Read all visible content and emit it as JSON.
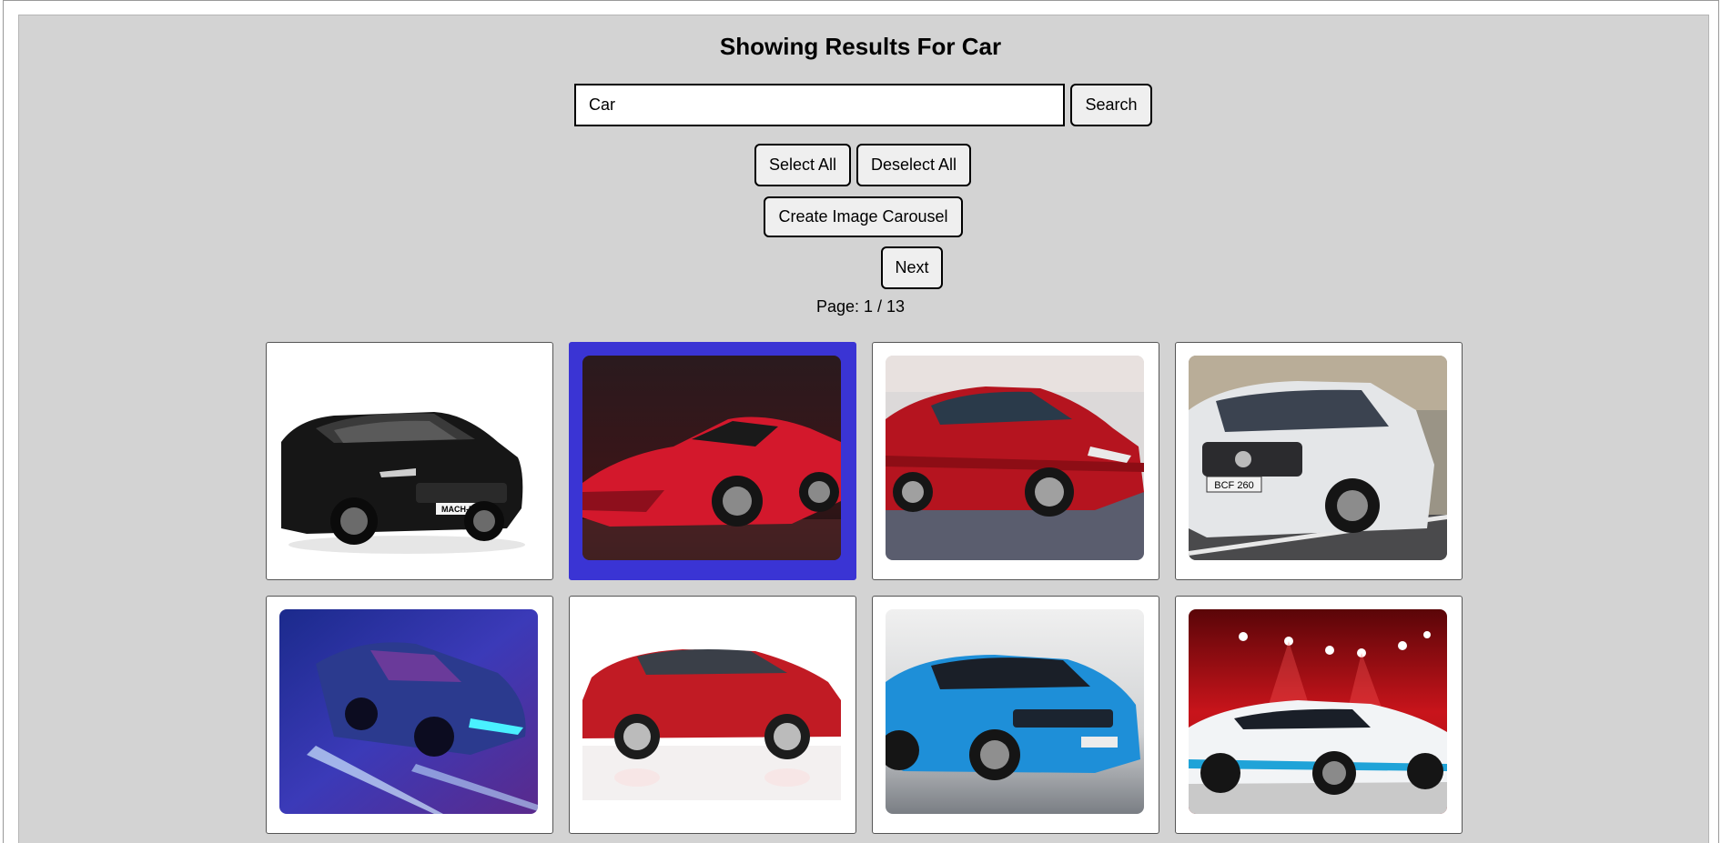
{
  "header": {
    "title": "Showing Results For Car"
  },
  "search": {
    "value": "Car",
    "button_label": "Search"
  },
  "selection": {
    "select_all_label": "Select All",
    "deselect_all_label": "Deselect All"
  },
  "carousel": {
    "create_label": "Create Image Carousel"
  },
  "pagination": {
    "next_label": "Next",
    "page_text": "Page: 1 / 13",
    "current": 1,
    "total": 13
  },
  "colors": {
    "selected_border": "#3a34d4",
    "panel_bg": "#d3d3d3"
  },
  "results": [
    {
      "subject": "black-suv-white-background",
      "selected": false,
      "plate": "MACH-E"
    },
    {
      "subject": "red-sports-car-dark-studio",
      "selected": true
    },
    {
      "subject": "red-sedan",
      "selected": false
    },
    {
      "subject": "white-suv-road",
      "selected": false,
      "plate": "BCF 260"
    },
    {
      "subject": "blue-supercar-neon",
      "selected": false
    },
    {
      "subject": "red-hatchback-white-background",
      "selected": false
    },
    {
      "subject": "blue-suv-studio",
      "selected": false
    },
    {
      "subject": "white-hypercar-red-lights",
      "selected": false
    }
  ]
}
